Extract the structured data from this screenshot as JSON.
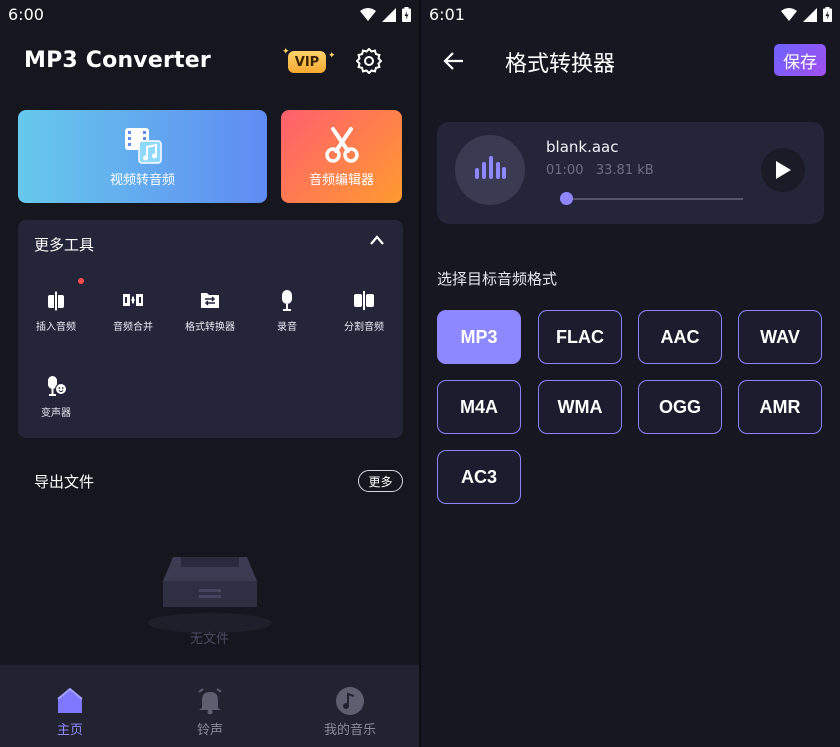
{
  "left": {
    "status_time": "6:00",
    "app_title": "MP3 Converter",
    "vip_label": "VIP",
    "tiles": {
      "video_to_audio": "视频转音频",
      "audio_editor": "音频编辑器"
    },
    "tools": {
      "title": "更多工具",
      "items": [
        {
          "label": "插入音频",
          "icon": "insert-audio-icon"
        },
        {
          "label": "音频合并",
          "icon": "merge-audio-icon"
        },
        {
          "label": "格式转换器",
          "icon": "format-converter-icon"
        },
        {
          "label": "录音",
          "icon": "microphone-icon"
        },
        {
          "label": "分割音频",
          "icon": "split-audio-icon"
        },
        {
          "label": "变声器",
          "icon": "voice-changer-icon"
        }
      ]
    },
    "export": {
      "title": "导出文件",
      "more_label": "更多",
      "empty_text": "无文件"
    },
    "nav": [
      {
        "label": "主页",
        "active": true,
        "icon": "home-icon"
      },
      {
        "label": "铃声",
        "active": false,
        "icon": "bell-icon"
      },
      {
        "label": "我的音乐",
        "active": false,
        "icon": "music-note-icon"
      }
    ]
  },
  "right": {
    "status_time": "6:01",
    "page_title": "格式转换器",
    "save_label": "保存",
    "file": {
      "name": "blank.aac",
      "duration": "01:00",
      "size": "33.81 kB"
    },
    "format_label": "选择目标音频格式",
    "formats": [
      "MP3",
      "FLAC",
      "AAC",
      "WAV",
      "M4A",
      "WMA",
      "OGG",
      "AMR",
      "AC3"
    ],
    "selected_format": "MP3"
  },
  "colors": {
    "accent": "#8e88ff",
    "background": "#16161f",
    "card": "#25253a"
  }
}
